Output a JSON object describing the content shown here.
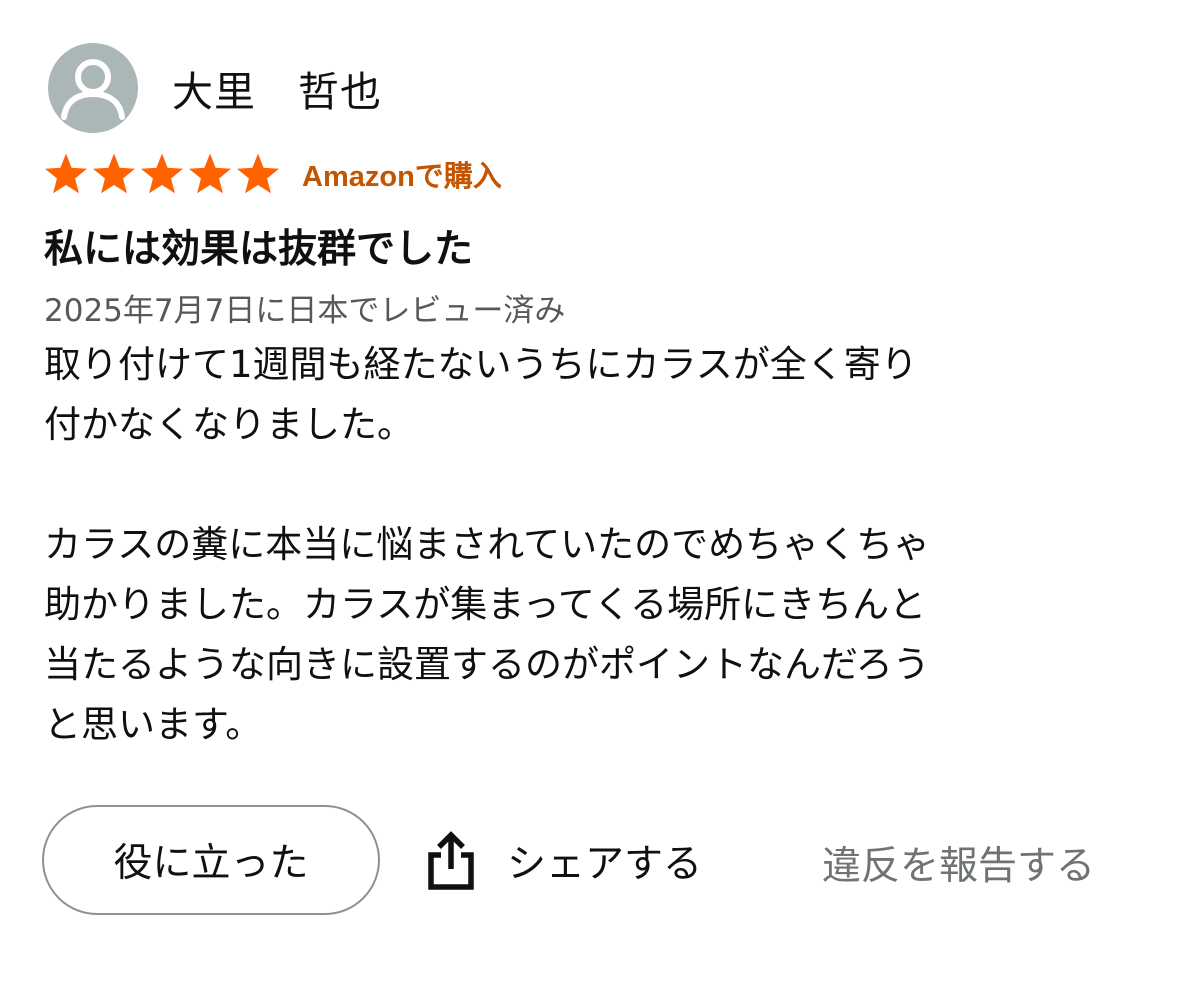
{
  "reviewer": {
    "name": "大里　哲也",
    "avatar_icon": "default-user-icon"
  },
  "rating": {
    "stars": 5,
    "max_stars": 5,
    "star_color": "#ff6200",
    "verified_label": "Amazonで購入",
    "verified_color": "#c45500"
  },
  "review": {
    "title": "私には効果は抜群でした",
    "date": "2025年7月7日に日本でレビュー済み",
    "paragraphs": [
      [
        "取り付けて1週間も経たないうちにカラスが全く寄り",
        "付かなくなりました。"
      ],
      [
        "カラスの糞に本当に悩まされていたのでめちゃくちゃ",
        "助かりました。カラスが集まってくる場所にきちんと",
        "当たるような向きに設置するのがポイントなんだろう",
        "と思います。"
      ]
    ]
  },
  "actions": {
    "helpful_label": "役に立った",
    "share_label": "シェアする",
    "share_icon": "share-icon",
    "report_label": "違反を報告する"
  }
}
